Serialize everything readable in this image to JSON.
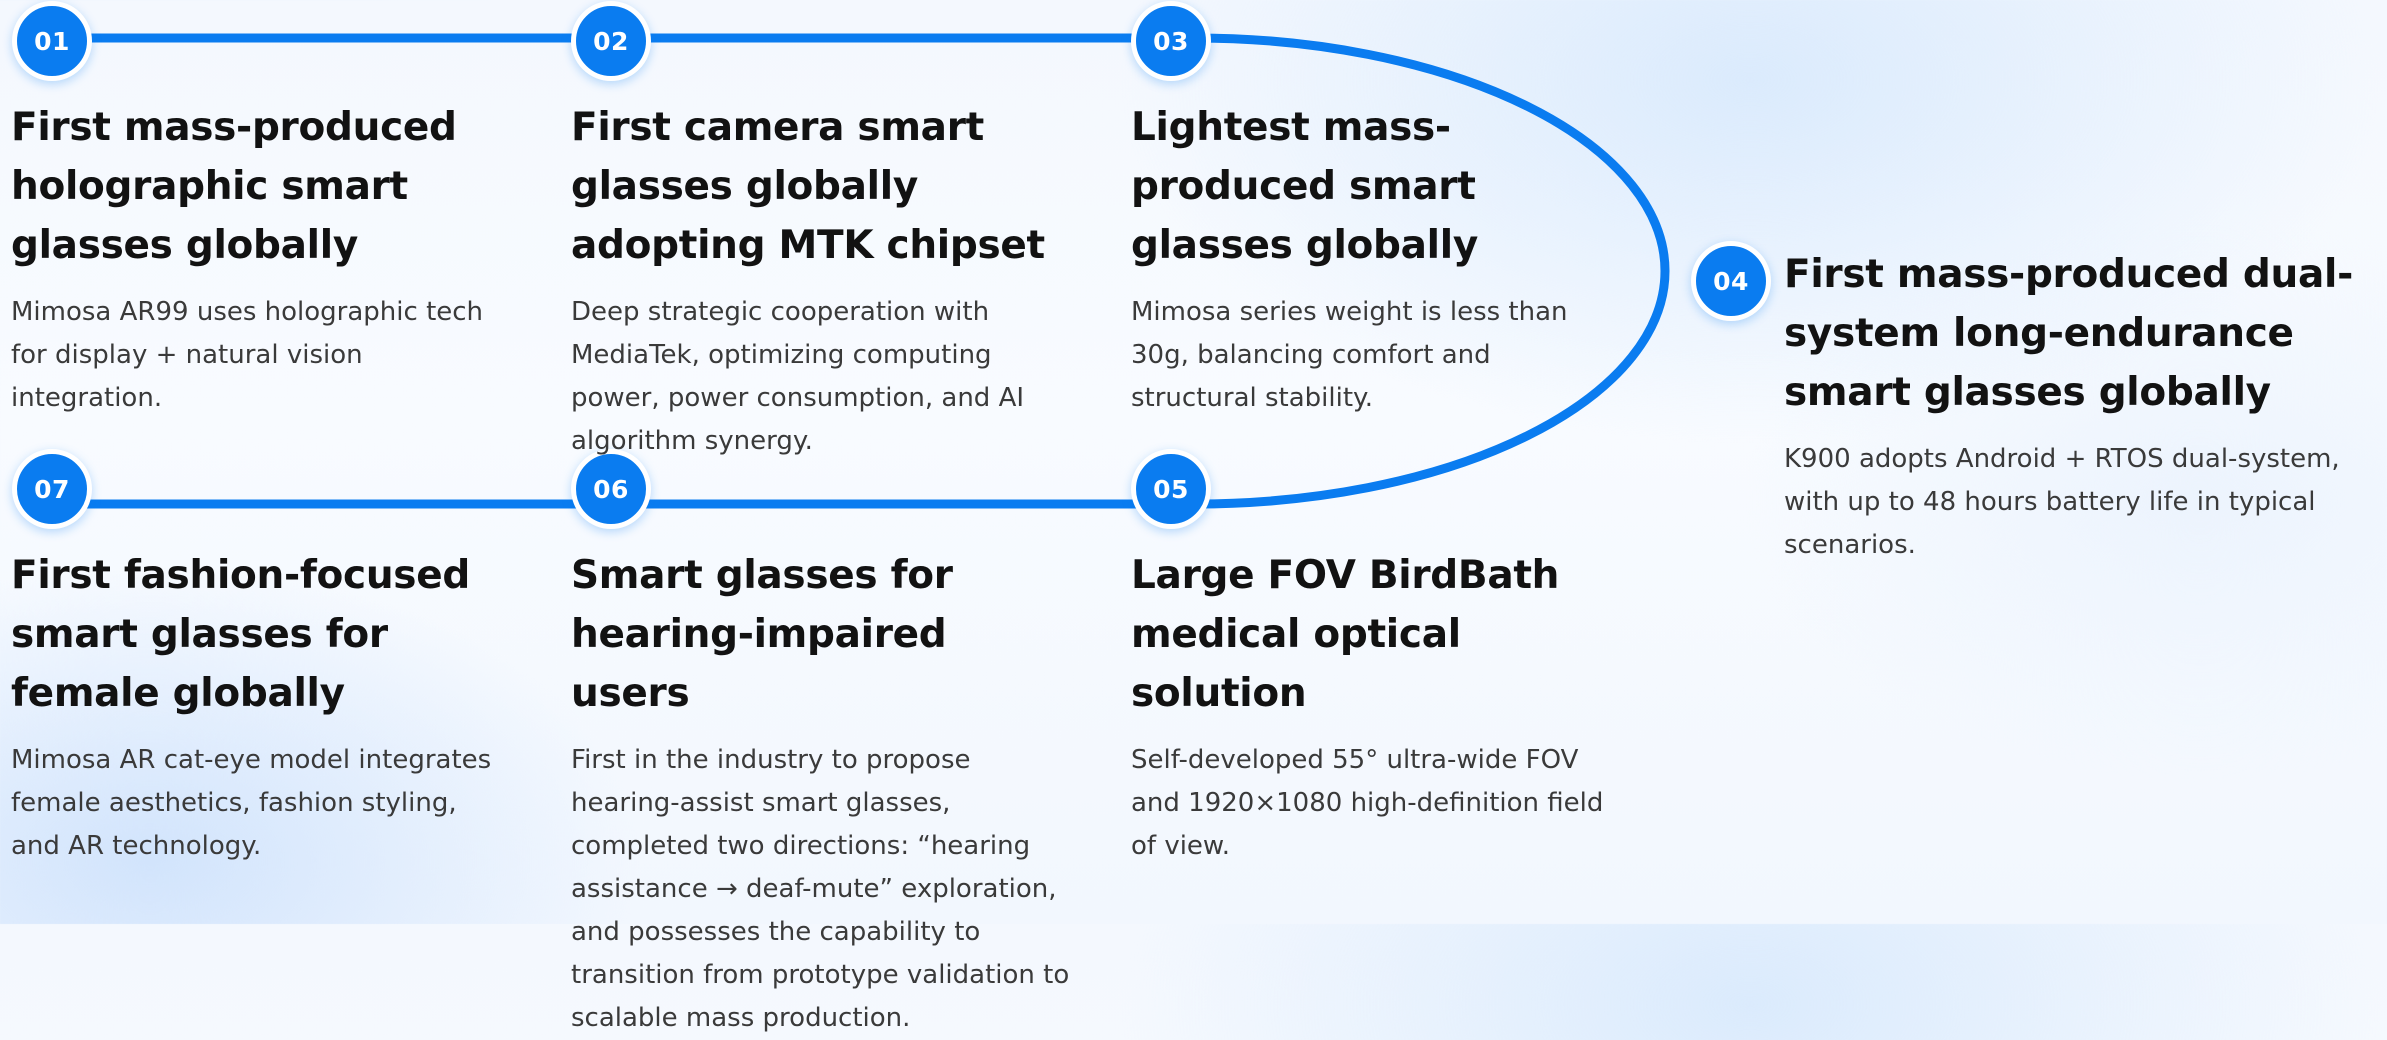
{
  "milestones": [
    {
      "number": "01",
      "title": "First mass-produced holographic smart glasses globally",
      "description": "Mimosa AR99 uses holographic tech for display + natural vision integration."
    },
    {
      "number": "02",
      "title": "First camera smart glasses globally adopting MTK chipset",
      "description": "Deep strategic cooperation with MediaTek, optimizing computing power, power consumption, and AI algorithm synergy."
    },
    {
      "number": "03",
      "title": "Lightest mass-produced smart glasses globally",
      "description": "Mimosa series weight is less than 30g, balancing comfort and structural stability."
    },
    {
      "number": "04",
      "title": "First mass-produced dual-system long-endurance smart glasses globally",
      "description": "K900 adopts Android + RTOS dual-system, with up to 48 hours battery life in typical scenarios."
    },
    {
      "number": "05",
      "title": "Large FOV BirdBath medical optical solution",
      "description": "Self-developed 55° ultra-wide FOV and 1920×1080 high-definition field of view."
    },
    {
      "number": "06",
      "title": "Smart glasses for hearing-impaired users",
      "description": "First in the industry to propose hearing-assist smart glasses, completed two directions: “hearing assistance → deaf-mute” exploration, and possesses the capability to transition from prototype validation to scalable mass production."
    },
    {
      "number": "07",
      "title": "First fashion-focused smart glasses for female globally",
      "description": "Mimosa AR cat-eye model integrates female aesthetics, fashion styling, and AR technology."
    }
  ],
  "colors": {
    "accent": "#0a7cf0",
    "title_text": "#121212",
    "body_text": "#3a3a3a"
  }
}
